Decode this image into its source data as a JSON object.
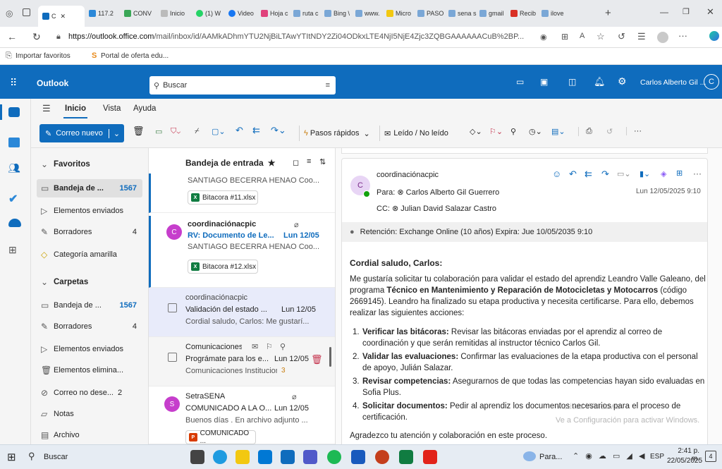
{
  "browser": {
    "tabs": [
      "117.2",
      "CONV",
      "Inicio",
      "(1) W",
      "Video",
      "Hoja c",
      "ruta c",
      "Bing \\",
      "www.",
      "Micro",
      "PASO",
      "sena s",
      "gmail",
      "Recib",
      "ilove"
    ],
    "active_tab_label": "C",
    "url_host": "https://outlook.office.com",
    "url_path": "/mail/inbox/id/AAMkADhmYTU2NjBiLTAwYTItNDY2Zi04ODkxLTE4NjI5NjE4Zjc3ZQBGAAAAAACuB%2BP...",
    "bookmarks": [
      "Importar favoritos",
      "Portal de oferta edu..."
    ]
  },
  "outlook": {
    "app_name": "Outlook",
    "search_placeholder": "Buscar",
    "user_name": "Carlos Alberto Gil ...",
    "user_initial": "C"
  },
  "ribbon": {
    "tabs": [
      "Inicio",
      "Vista",
      "Ayuda"
    ],
    "new_mail": "Correo nuevo",
    "quick_steps": "Pasos rápidos",
    "read_unread": "Leído / No leído"
  },
  "folders": {
    "favorites_header": "Favoritos",
    "favorites": [
      {
        "label": "Bandeja de ...",
        "count": "1567"
      },
      {
        "label": "Elementos enviados",
        "count": ""
      },
      {
        "label": "Borradores",
        "count": "4"
      },
      {
        "label": "Categoría amarilla",
        "count": ""
      }
    ],
    "folders_header": "Carpetas",
    "items": [
      {
        "label": "Bandeja de ...",
        "count": "1567"
      },
      {
        "label": "Borradores",
        "count": "4"
      },
      {
        "label": "Elementos enviados",
        "count": ""
      },
      {
        "label": "Elementos elimina...",
        "count": ""
      },
      {
        "label": "Correo no dese...",
        "count": "2"
      },
      {
        "label": "Notas",
        "count": ""
      },
      {
        "label": "Archivo",
        "count": ""
      }
    ]
  },
  "message_list": {
    "title": "Bandeja de entrada",
    "messages": [
      {
        "sender": "",
        "subject": "",
        "date": "",
        "preview": "SANTIAGO BECERRA HENAO Coo...",
        "attachment": "Bitacora #11.xlsx",
        "initial": ""
      },
      {
        "sender": "coordinaciónacpic",
        "subject": "RV: Documento de Le...",
        "date": "Lun 12/05",
        "preview": "SANTIAGO BECERRA HENAO Coo...",
        "attachment": "Bitacora #12.xlsx",
        "initial": "C"
      },
      {
        "sender": "coordinaciónacpic",
        "subject": "Validación del estado ...",
        "date": "Lun 12/05",
        "preview": "Cordial saludo, Carlos: Me gustarí...",
        "attachment": "",
        "initial": ""
      },
      {
        "sender": "Comunicaciones...",
        "subject": "Prográmate para los e...",
        "date": "Lun 12/05",
        "preview": "Comunicaciones Institucion...",
        "attachment": "",
        "initial": "",
        "badge": "3"
      },
      {
        "sender": "SetraSENA",
        "subject": "COMUNICADO A LA O...",
        "date": "Lun 12/05",
        "preview": "Buenos días . En archivo adjunto ...",
        "attachment": "COMUNICADO ...",
        "initial": "S"
      }
    ]
  },
  "reading": {
    "sender": "coordinaciónacpic",
    "initial": "C",
    "to_label": "Para:",
    "to": "Carlos Alberto Gil Guerrero",
    "cc_label": "CC:",
    "cc": "Julian David Salazar Castro",
    "date": "Lun 12/05/2025 9:10",
    "retention": "Retención: Exchange Online (10 años) Expira: Jue 10/05/2035 9:10",
    "greeting": "Cordial saludo, Carlos:",
    "p1_a": "Me gustaría solicitar tu colaboración para validar el estado del aprendiz Leandro Valle Galeano, del programa ",
    "p1_bold": "Técnico en Mantenimiento y Reparación de Motocicletas y Motocarros",
    "p1_b": " (código 2669145). Leandro ha finalizado su etapa productiva y necesita certificarse. Para ello, debemos realizar las siguientes acciones:",
    "actions": [
      {
        "n": "1.",
        "title": "Verificar las bitácoras:",
        "text": " Revisar las bitácoras enviadas por el aprendiz al correo de coordinación y que serán remitidas al instructor técnico Carlos Gil."
      },
      {
        "n": "2.",
        "title": "Validar las evaluaciones:",
        "text": " Confirmar las evaluaciones de la etapa productiva con el personal de apoyo, Julián Salazar."
      },
      {
        "n": "3.",
        "title": "Revisar competencias:",
        "text": " Asegurarnos de que todas las competencias hayan sido evaluadas en Sofia Plus."
      },
      {
        "n": "4.",
        "title": "Solicitar documentos:",
        "text": " Pedir al aprendiz los documentos necesarios para el proceso de certificación."
      }
    ],
    "closing": "Agradezco tu atención y colaboración en este proceso.",
    "watermark_1": "Activar Windows",
    "watermark_2": "Ve a Configuración para activar Windows."
  },
  "taskbar": {
    "search": "Buscar",
    "weather": "Para...",
    "lang": "ESP",
    "time": "2:41 p. m.",
    "date": "22/05/2025",
    "notif": "4"
  }
}
